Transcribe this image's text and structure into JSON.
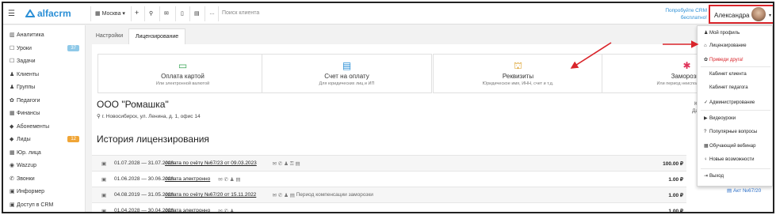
{
  "topbar": {
    "logo": "alfacrm",
    "city": "Москва",
    "search_placeholder": "Поиск клиента",
    "try_label": "Попробуйте CRM бесплатно!",
    "user_name": "Александра"
  },
  "sidebar": {
    "items": [
      {
        "icon": "▥",
        "label": "Аналитика"
      },
      {
        "icon": "☐",
        "label": "Уроки",
        "badge": "37",
        "badge_color": "#8fc9e8"
      },
      {
        "icon": "☐",
        "label": "Задачи"
      },
      {
        "icon": "♟",
        "label": "Клиенты"
      },
      {
        "icon": "♟",
        "label": "Группы"
      },
      {
        "icon": "✿",
        "label": "Педагоги"
      },
      {
        "icon": "▦",
        "label": "Финансы"
      },
      {
        "icon": "◆",
        "label": "Абонементы"
      },
      {
        "icon": "◆",
        "label": "Лиды",
        "badge": "12",
        "badge_color": "#f0a536"
      },
      {
        "icon": "▦",
        "label": "Юр. лица"
      },
      {
        "icon": "◉",
        "label": "Wazzup"
      },
      {
        "icon": "✆",
        "label": "Звонки"
      },
      {
        "icon": "▣",
        "label": "Информер"
      },
      {
        "icon": "▣",
        "label": "Доступ в CRM"
      }
    ]
  },
  "tabs": [
    "Настройки",
    "Лицензирование"
  ],
  "cards": [
    {
      "title": "Оплата картой",
      "sub": "Или электронной валютой",
      "icon": "▭",
      "color": "#3aa655"
    },
    {
      "title": "Счет на оплату",
      "sub": "Для юридических лиц и ИП",
      "icon": "▤",
      "color": "#2b8fd6"
    },
    {
      "title": "Реквизиты",
      "sub": "Юридическое имя, ИНН, счет и т.д.",
      "icon": "⛫",
      "color": "#d99a1e"
    },
    {
      "title": "Заморозка",
      "sub": "Или период неиспользования",
      "icon": "✱",
      "color": "#e0345a"
    }
  ],
  "company": {
    "name": "ООО \"Ромашка\"",
    "address": "г. Новосибирск, ул. Ленина, д. 1, офис 14"
  },
  "right_labels": [
    "Ку",
    "Дат"
  ],
  "history": {
    "title": "История лицензирования",
    "rows": [
      {
        "period": "01.07.2028 — 31.07.2028",
        "link": "оплата по счёту №67/23 от 09.03.2023",
        "icons": "✉ ✆ ♟ ⚿ ▤",
        "note": "",
        "amount": "100.00 ₽"
      },
      {
        "period": "01.06.2028 — 30.06.2028",
        "link": "оплата электронно",
        "icons": "✉ ✆ ♟ ▤",
        "note": "",
        "amount": "1.00 ₽"
      },
      {
        "period": "04.08.2019 — 31.05.2028",
        "link": "оплата по счёту №67/20 от 15.11.2022",
        "icons": "✉ ✆ ♟ ▤",
        "note": "Период компенсации заморозки",
        "amount": "1.00 ₽"
      },
      {
        "period": "01.04.2028 — 30.04.2028",
        "link": "оплата электронно",
        "icons": "✉ ✆ ♟",
        "note": "",
        "amount": "1.00 ₽"
      }
    ],
    "act_link": "Акт №67/20"
  },
  "menu": {
    "items": [
      {
        "icon": "♟",
        "label": "Мой профиль"
      },
      {
        "icon": "⌂",
        "label": "Лицензирование"
      },
      {
        "icon": "✿",
        "label": "Приведи друга!",
        "friend": true
      },
      {
        "icon": "",
        "label": "Кабинет клиента"
      },
      {
        "icon": "",
        "label": "Кабинет педагога"
      },
      {
        "icon": "✓",
        "label": "Администрирование"
      },
      {
        "icon": "▶",
        "label": "Видеоуроки"
      },
      {
        "icon": "?",
        "label": "Популярные вопросы"
      },
      {
        "icon": "▦",
        "label": "Обучающий вебинар"
      },
      {
        "icon": "♀",
        "label": "Новые возможности"
      },
      {
        "icon": "⇥",
        "label": "Выход"
      }
    ]
  },
  "accent": "#d9252b"
}
